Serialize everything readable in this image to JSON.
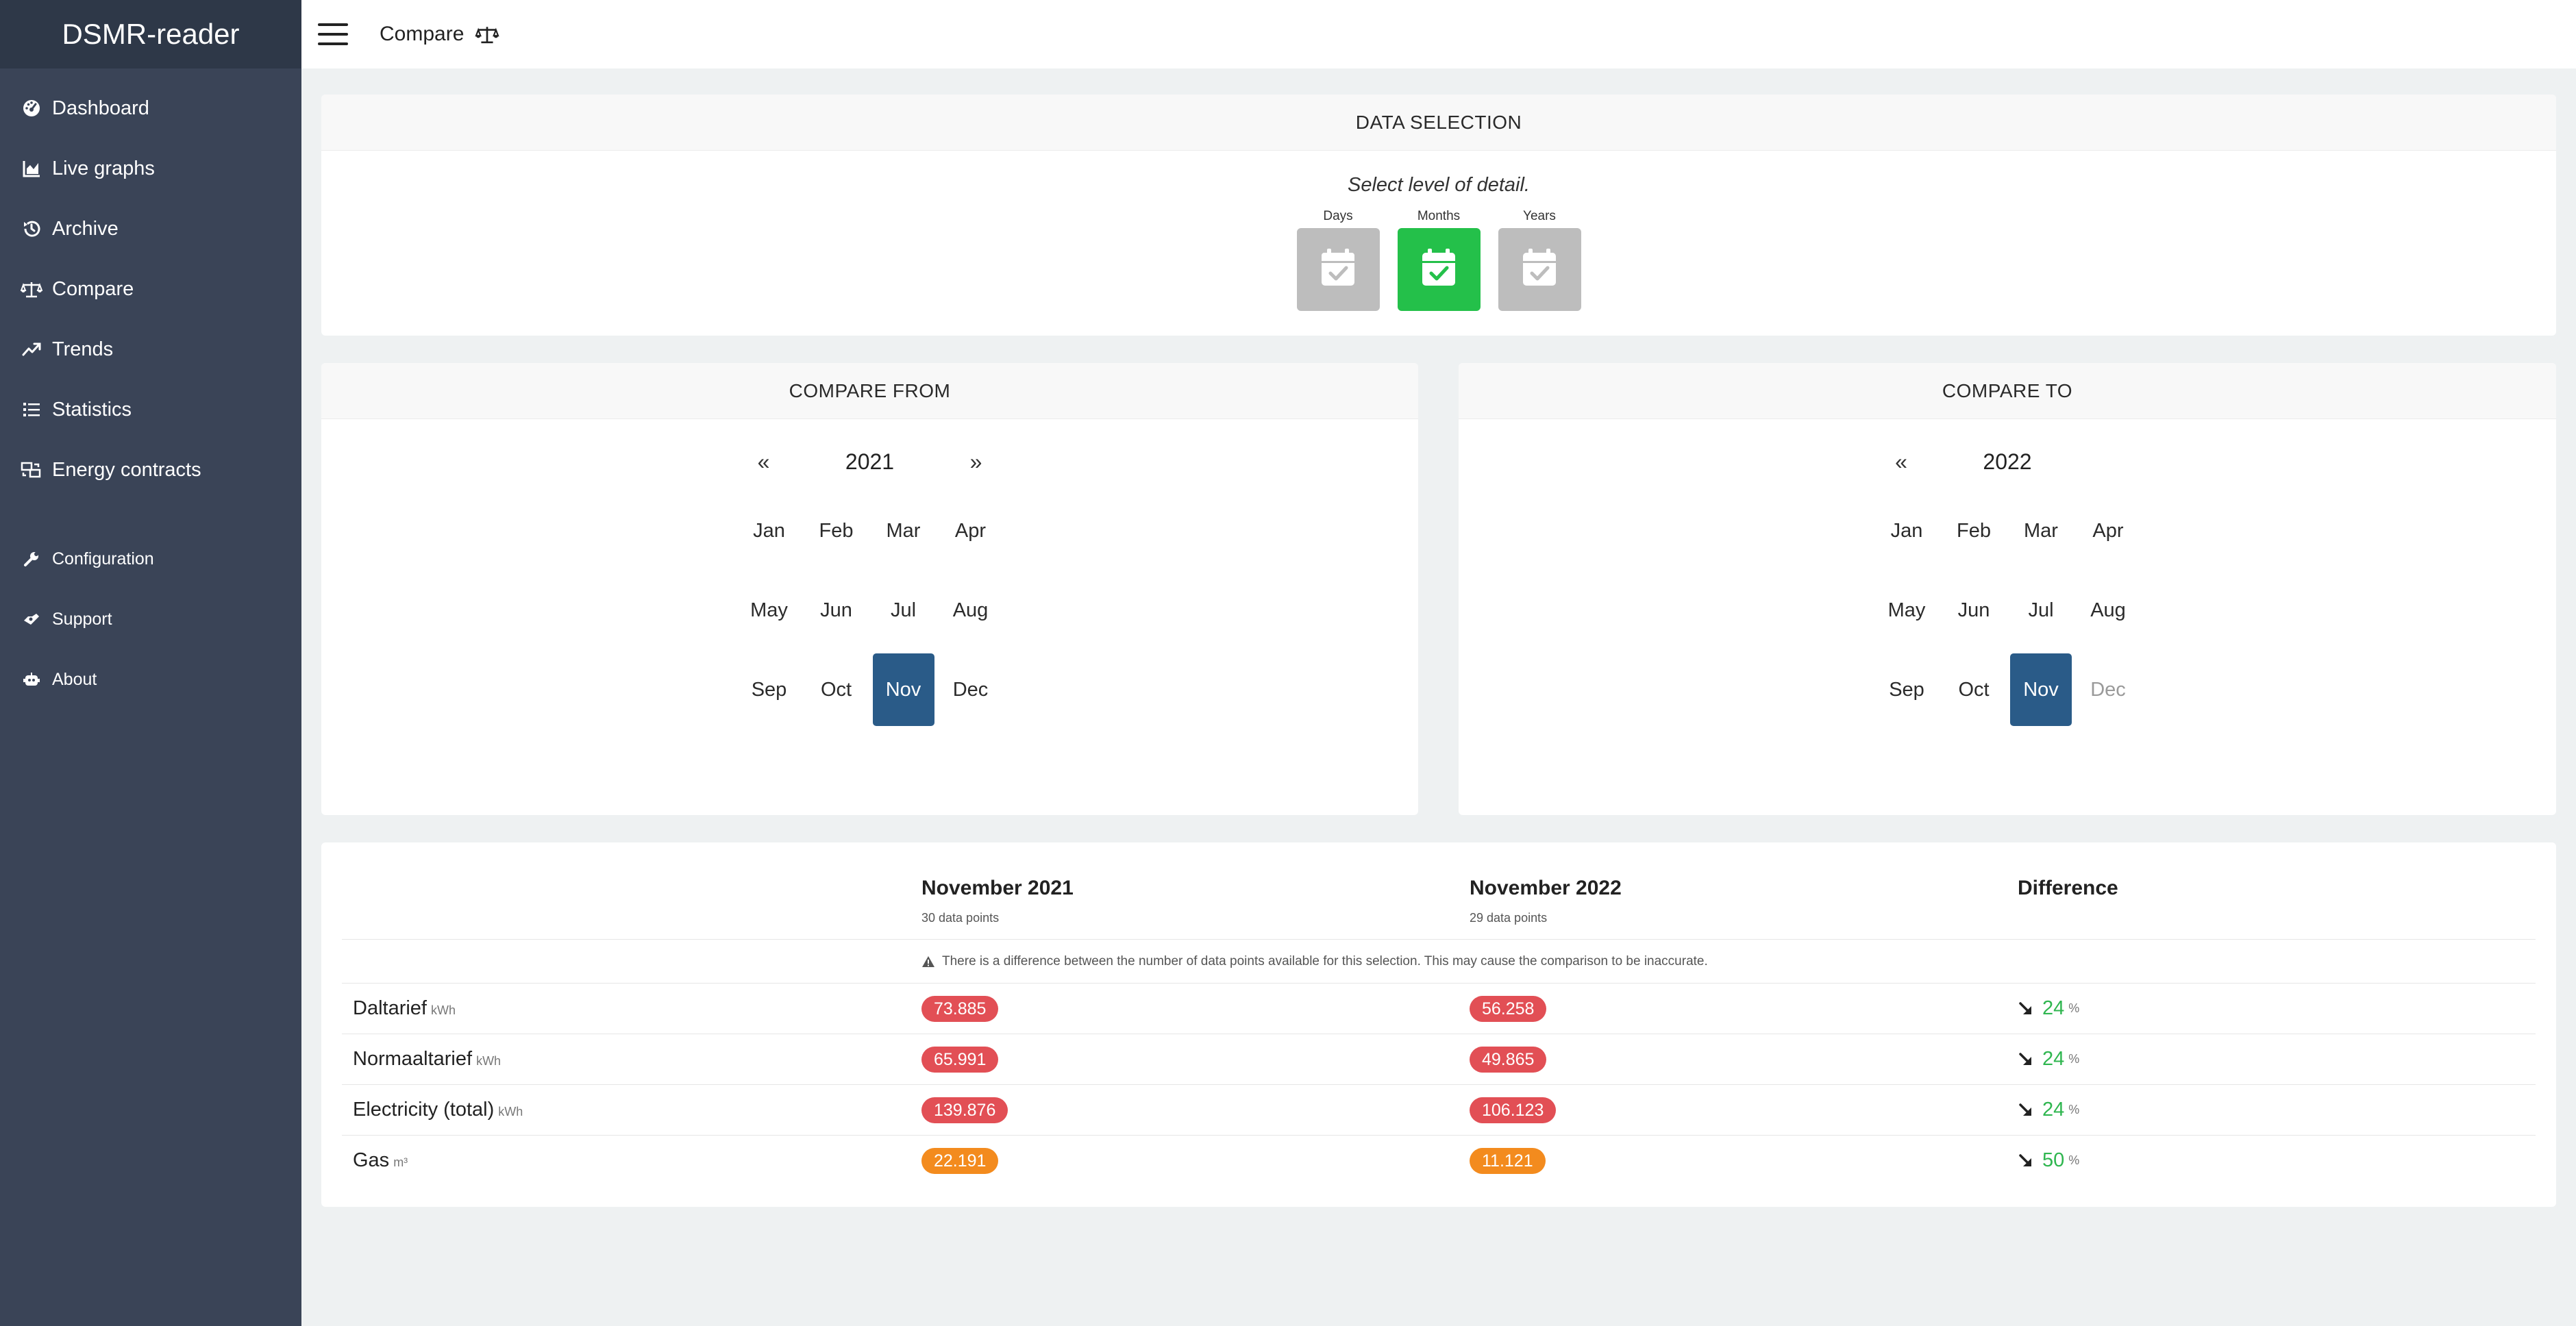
{
  "app": {
    "brand": "DSMR-reader"
  },
  "sidebar": {
    "items": [
      {
        "label": "Dashboard",
        "icon": "dashboard-icon"
      },
      {
        "label": "Live graphs",
        "icon": "area-chart-icon"
      },
      {
        "label": "Archive",
        "icon": "history-icon"
      },
      {
        "label": "Compare",
        "icon": "balance-scale-icon"
      },
      {
        "label": "Trends",
        "icon": "trend-up-icon"
      },
      {
        "label": "Statistics",
        "icon": "list-icon"
      },
      {
        "label": "Energy contracts",
        "icon": "contracts-icon"
      }
    ],
    "secondary": [
      {
        "label": "Configuration",
        "icon": "wrench-icon"
      },
      {
        "label": "Support",
        "icon": "support-icon"
      },
      {
        "label": "About",
        "icon": "robot-icon"
      }
    ]
  },
  "topbar": {
    "title": "Compare",
    "icon": "balance-scale-icon"
  },
  "selection": {
    "header": "DATA SELECTION",
    "prompt": "Select level of detail.",
    "levels": [
      {
        "label": "Days",
        "active": false
      },
      {
        "label": "Months",
        "active": true
      },
      {
        "label": "Years",
        "active": false
      }
    ],
    "colors": {
      "active": "#24c04a",
      "inactive": "#bdbdbd"
    }
  },
  "compare_from": {
    "header": "COMPARE FROM",
    "prev": "«",
    "next": "»",
    "year": "2021",
    "months": [
      "Jan",
      "Feb",
      "Mar",
      "Apr",
      "May",
      "Jun",
      "Jul",
      "Aug",
      "Sep",
      "Oct",
      "Nov",
      "Dec"
    ],
    "selected": "Nov"
  },
  "compare_to": {
    "header": "COMPARE TO",
    "prev": "«",
    "year": "2022",
    "months": [
      "Jan",
      "Feb",
      "Mar",
      "Apr",
      "May",
      "Jun",
      "Jul",
      "Aug",
      "Sep",
      "Oct",
      "Nov",
      "Dec"
    ],
    "selected": "Nov",
    "disabled": [
      "Dec"
    ]
  },
  "results": {
    "col1": {
      "title": "November 2021",
      "sub": "30 data points"
    },
    "col2": {
      "title": "November 2022",
      "sub": "29 data points"
    },
    "col3": {
      "title": "Difference"
    },
    "warning": "There is a difference between the number of data points available for this selection. This may cause the comparison to be inaccurate.",
    "rows": [
      {
        "label": "Daltarief",
        "unit": "kWh",
        "v1": "73.885",
        "v2": "56.258",
        "diff": "24",
        "pct": "%"
      },
      {
        "label": "Normaaltarief",
        "unit": "kWh",
        "v1": "65.991",
        "v2": "49.865",
        "diff": "24",
        "pct": "%"
      },
      {
        "label": "Electricity (total)",
        "unit": "kWh",
        "v1": "139.876",
        "v2": "106.123",
        "diff": "24",
        "pct": "%"
      },
      {
        "label": "Gas",
        "unit": "m³",
        "v1": "22.191",
        "v2": "11.121",
        "diff": "50",
        "pct": "%"
      }
    ],
    "colors": {
      "electricity": "#e24f55",
      "gas": "#f38b1e",
      "decrease": "#2fb64f",
      "selected_month": "#2a5b88"
    }
  }
}
